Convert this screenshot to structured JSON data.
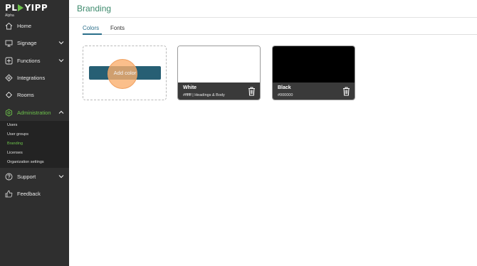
{
  "app": {
    "logo_left": "PL",
    "logo_right": "YIPP",
    "logo_sub": "Alpha"
  },
  "sidebar": {
    "items": [
      {
        "label": "Home",
        "icon": "home-icon"
      },
      {
        "label": "Signage",
        "icon": "signage-icon",
        "expandable": true
      },
      {
        "label": "Functions",
        "icon": "functions-icon",
        "expandable": true
      },
      {
        "label": "Integrations",
        "icon": "integrations-icon"
      },
      {
        "label": "Rooms",
        "icon": "rooms-icon"
      },
      {
        "label": "Administration",
        "icon": "administration-icon",
        "expandable": true,
        "expanded": true,
        "active": true
      },
      {
        "label": "Support",
        "icon": "support-icon",
        "expandable": true
      },
      {
        "label": "Feedback",
        "icon": "feedback-icon"
      }
    ],
    "admin_sub_items": [
      {
        "label": "Users"
      },
      {
        "label": "User groups"
      },
      {
        "label": "Branding",
        "active": true
      },
      {
        "label": "Licenses"
      },
      {
        "label": "Organization settings"
      }
    ]
  },
  "page": {
    "title": "Branding",
    "tabs": [
      {
        "label": "Colors",
        "active": true
      },
      {
        "label": "Fonts"
      }
    ],
    "add_button_label": "Add color",
    "colors": [
      {
        "name": "White",
        "description": "#ffffff | Headings & Body",
        "hex": "#ffffff"
      },
      {
        "name": "Black",
        "description": "#000000",
        "hex": "#000000"
      }
    ]
  },
  "theme": {
    "accent_green": "#6cc24a",
    "title_color": "#3d8a6d",
    "button_blue": "#275f74",
    "sidebar_bg": "#2f2f2f",
    "highlight_orange": "#f0a060"
  }
}
